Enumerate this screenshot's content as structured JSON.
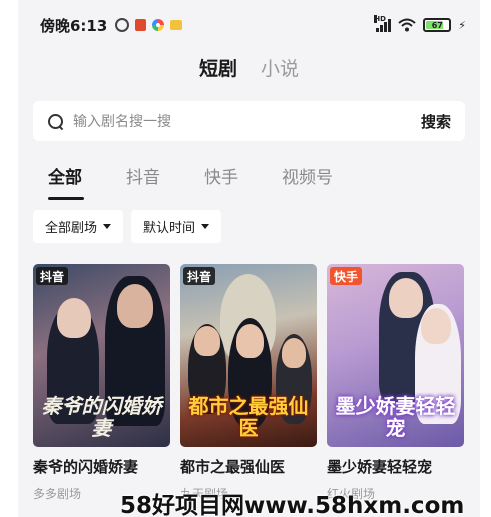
{
  "status_bar": {
    "time": "傍晚6:13",
    "network": "HD",
    "battery": "67"
  },
  "top_tabs": [
    {
      "label": "短剧",
      "active": true
    },
    {
      "label": "小说",
      "active": false
    }
  ],
  "search": {
    "placeholder": "输入剧名搜一搜",
    "button": "搜索"
  },
  "platform_tabs": [
    {
      "label": "全部",
      "active": true
    },
    {
      "label": "抖音",
      "active": false
    },
    {
      "label": "快手",
      "active": false
    },
    {
      "label": "视频号",
      "active": false
    }
  ],
  "filters": [
    {
      "label": "全部剧场"
    },
    {
      "label": "默认时间"
    }
  ],
  "cards": [
    {
      "badge": "抖音",
      "poster_text": "秦爷的闪婚娇妻",
      "title": "秦爷的闪婚娇妻",
      "source": "多多剧场"
    },
    {
      "badge": "抖音",
      "poster_text": "都市之最强仙医",
      "title": "都市之最强仙医",
      "source": "九天剧场"
    },
    {
      "badge": "快手",
      "poster_text": "墨少娇妻轻轻宠",
      "title": "墨少娇妻轻轻宠",
      "source": "红火剧场"
    }
  ],
  "watermark": "58好项目网www.58hxm.com",
  "colors": {
    "page_bg": "#f4f4f6",
    "badge_douyin": "#1a1a1a",
    "badge_kuaishou": "#f2542d"
  }
}
